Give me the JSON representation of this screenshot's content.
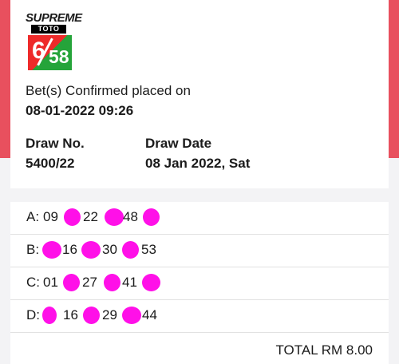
{
  "logo": {
    "brand": "SUPREME",
    "game": "TOTO",
    "num_left": "6",
    "num_right": "58",
    "tile_colors": [
      "#ee2a2a",
      "#25a43a"
    ]
  },
  "confirmation": {
    "text": "Bet(s) Confirmed placed on",
    "datetime": "08-01-2022 09:26"
  },
  "draw": {
    "no_label": "Draw No.",
    "no_value": "5400/22",
    "date_label": "Draw Date",
    "date_value": "08 Jan 2022, Sat"
  },
  "bets": [
    {
      "label": "A:",
      "numbers": [
        "09",
        "22",
        "48"
      ]
    },
    {
      "label": "B:",
      "numbers": [
        "16",
        "30",
        "53"
      ]
    },
    {
      "label": "C:",
      "numbers": [
        "01",
        "27",
        "41"
      ]
    },
    {
      "label": "D:",
      "numbers": [
        "16",
        "29",
        "44"
      ]
    }
  ],
  "total": "TOTAL RM 8.00",
  "colors": {
    "header_red": "#e8505e",
    "redaction": "#ff10e8"
  }
}
